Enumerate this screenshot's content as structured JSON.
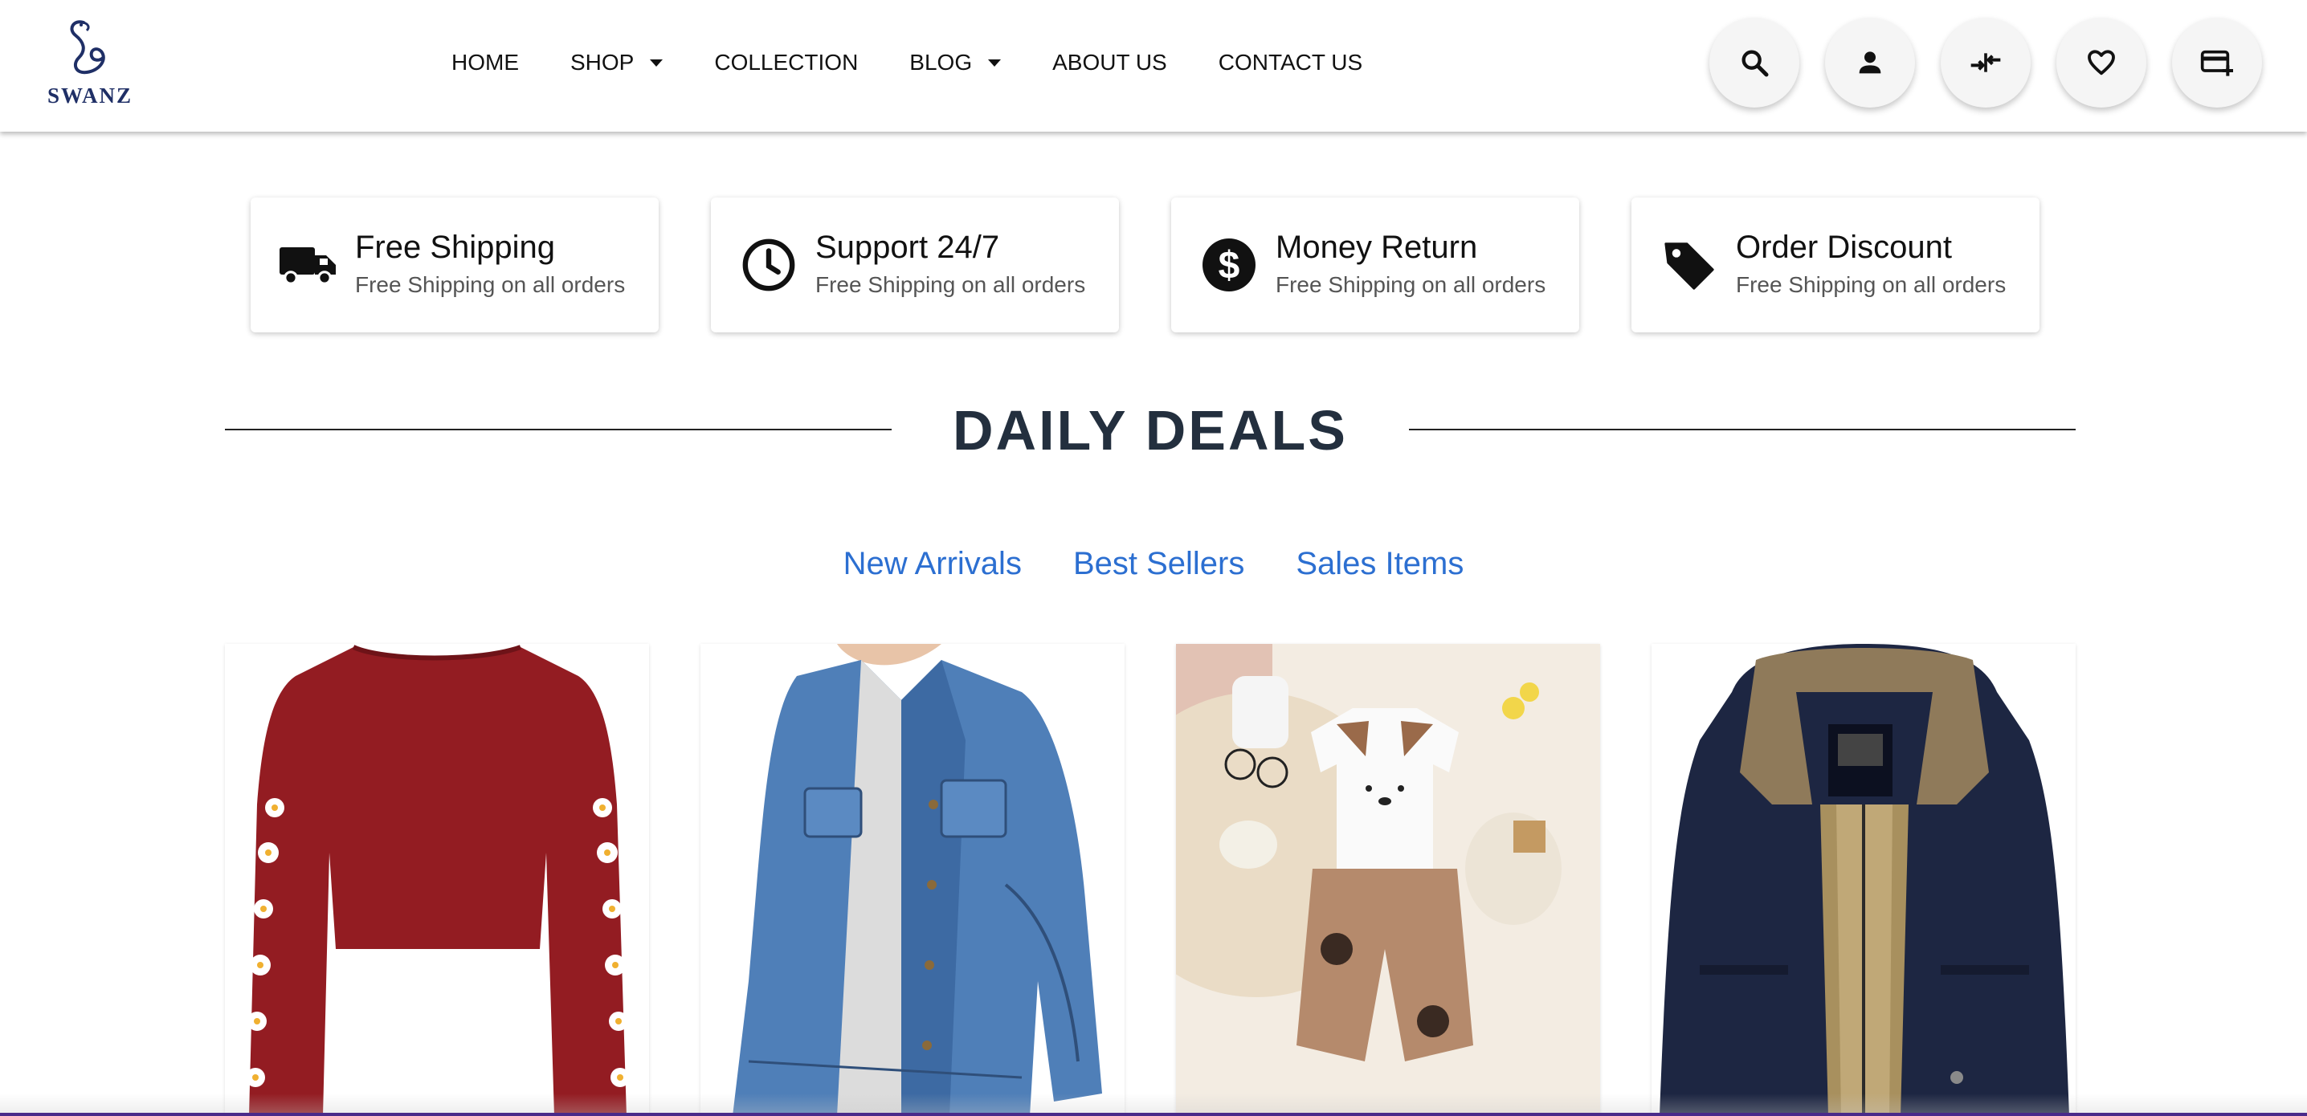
{
  "brand": {
    "name": "SWANZ",
    "color": "#1f2f66"
  },
  "nav": [
    {
      "label": "HOME",
      "has_dropdown": false
    },
    {
      "label": "SHOP",
      "has_dropdown": true
    },
    {
      "label": "COLLECTION",
      "has_dropdown": false
    },
    {
      "label": "BLOG",
      "has_dropdown": true
    },
    {
      "label": "ABOUT US",
      "has_dropdown": false
    },
    {
      "label": "CONTACT US",
      "has_dropdown": false
    }
  ],
  "actions": [
    {
      "icon": "search-icon"
    },
    {
      "icon": "user-icon"
    },
    {
      "icon": "compare-icon"
    },
    {
      "icon": "heart-icon"
    },
    {
      "icon": "card-add-icon"
    }
  ],
  "features": [
    {
      "icon": "truck-icon",
      "title": "Free Shipping",
      "subtitle": "Free Shipping on all orders"
    },
    {
      "icon": "clock-icon",
      "title": "Support 24/7",
      "subtitle": "Free Shipping on all orders"
    },
    {
      "icon": "dollar-icon",
      "title": "Money Return",
      "subtitle": "Free Shipping on all orders"
    },
    {
      "icon": "tag-icon",
      "title": "Order Discount",
      "subtitle": "Free Shipping on all orders"
    }
  ],
  "section": {
    "title": "DAILY DEALS"
  },
  "tabs": [
    {
      "label": "New Arrivals"
    },
    {
      "label": "Best Sellers"
    },
    {
      "label": "Sales Items"
    }
  ],
  "products": [
    {
      "image": "red-cropped-sweatshirt-image"
    },
    {
      "image": "denim-jacket-image"
    },
    {
      "image": "kids-tshirt-shorts-set-image"
    },
    {
      "image": "navy-fur-lined-parka-image"
    }
  ],
  "colors": {
    "tab_link": "#2c6fd1",
    "title": "#232f3e",
    "icon_button_bg": "#f5f5f5"
  }
}
